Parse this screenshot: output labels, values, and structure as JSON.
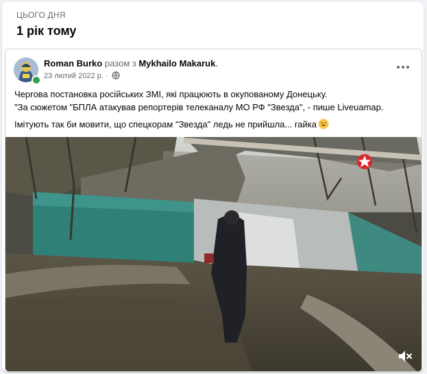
{
  "memory": {
    "label": "ЦЬОГО ДНЯ",
    "title": "1 рік тому"
  },
  "post": {
    "author": "Roman Burko",
    "with_word": " разом з ",
    "tagged": "Mykhailo Makaruk",
    "tagged_suffix": ".",
    "date": "23 лютий 2022 р.",
    "separator": " · ",
    "privacy_icon": "globe-icon",
    "more_icon": "more-horizontal-icon",
    "text_line1": "Чергова постановка російських ЗМІ, які працюють в окупованому Донецьку.",
    "text_line2": "\"За сюжетом \"БПЛА атакував репортерів телеканалу МО РФ \"Звезда\", - пише Liveuamap.",
    "text_line3": "Імітують так би мовити, що спецкорам \"Звезда\" ледь не прийшла... гайка",
    "emoji_icon": "smiley-emoji-icon"
  },
  "video": {
    "mute_icon": "speaker-muted-icon",
    "overlay_logo": "star-logo-icon"
  },
  "colors": {
    "online": "#31a24c",
    "text_secondary": "#65676b",
    "card_background": "#ffffff",
    "page_background": "#f0f2f5"
  }
}
